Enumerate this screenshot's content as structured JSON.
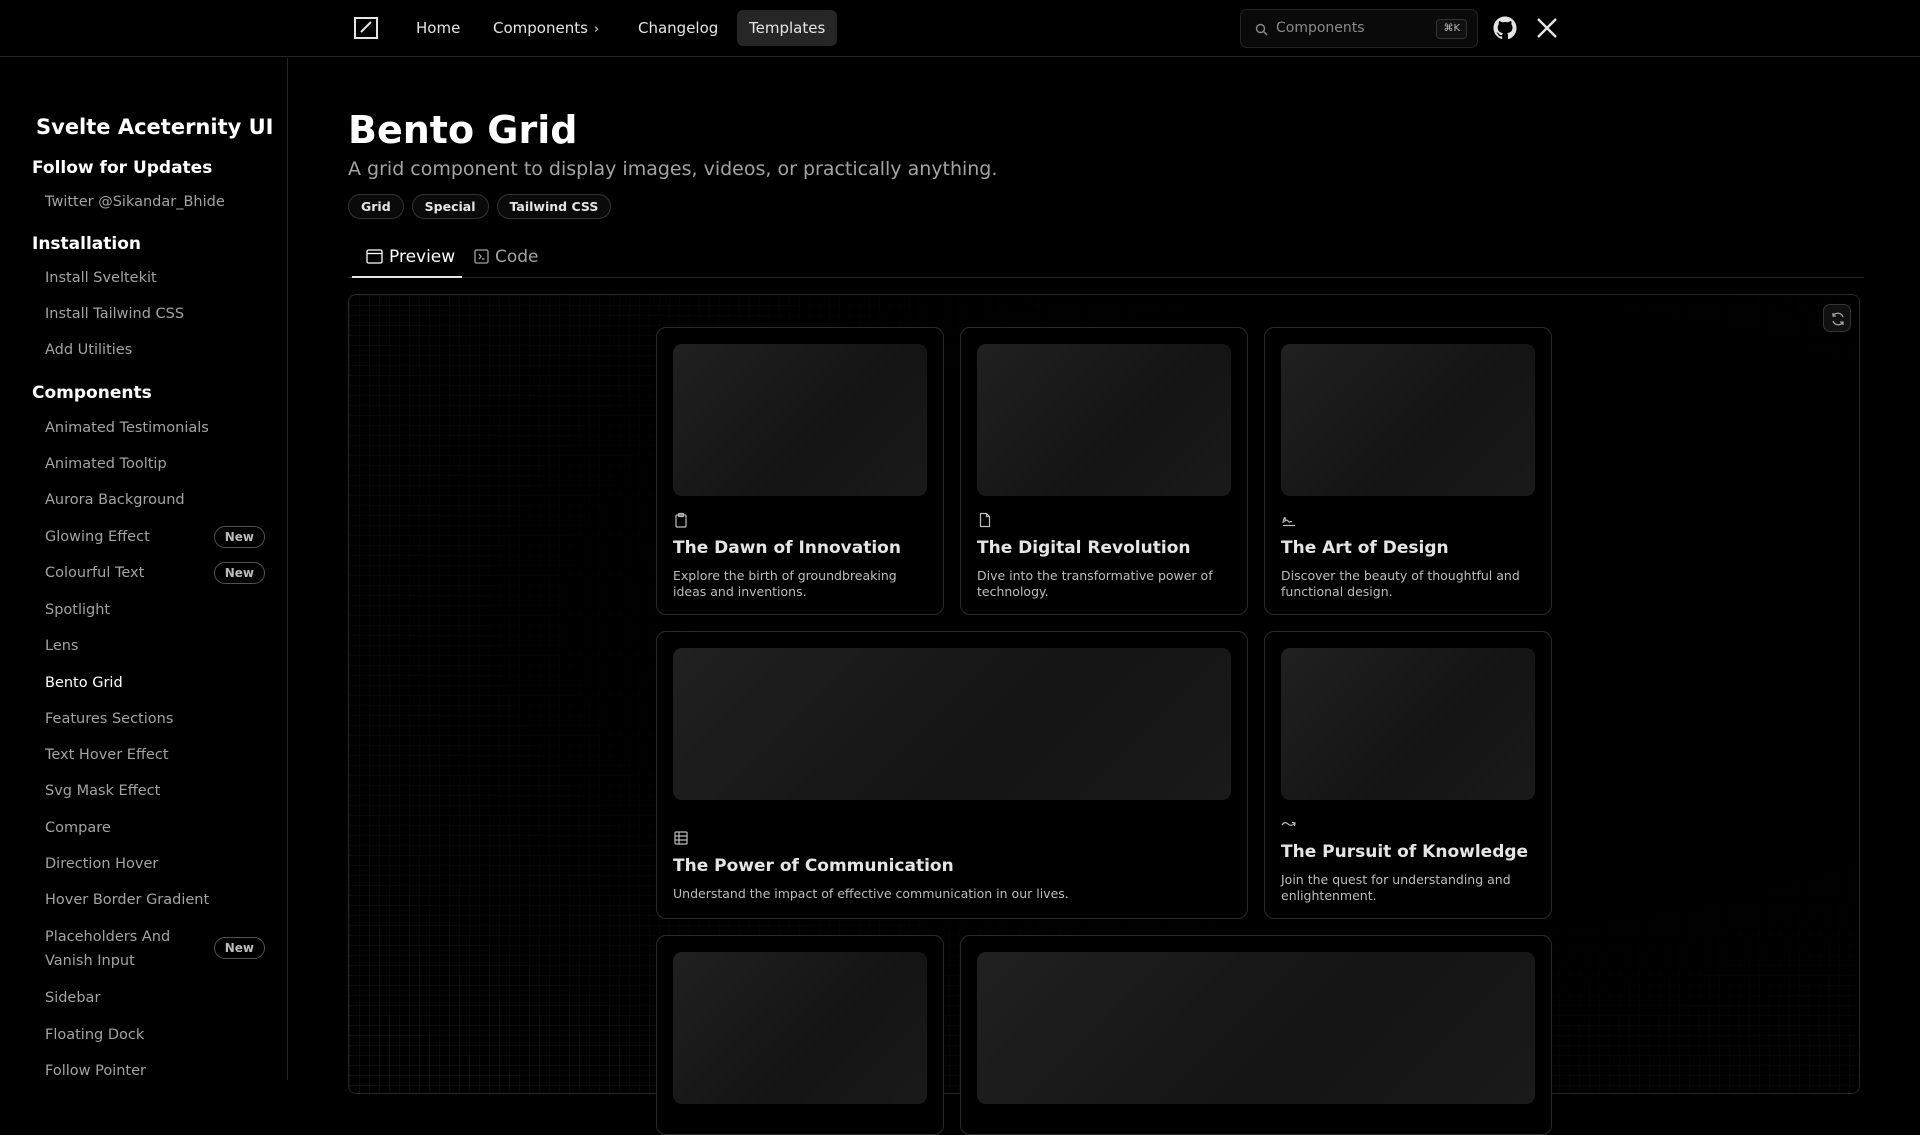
{
  "nav": {
    "home": "Home",
    "components": "Components",
    "changelog": "Changelog",
    "templates": "Templates",
    "search_placeholder": "Components",
    "search_shortcut": "⌘K"
  },
  "sidebar": {
    "brand": "Svelte Aceternity UI",
    "follow_title": "Follow for Updates",
    "twitter": "Twitter @Sikandar_Bhide",
    "installation_title": "Installation",
    "installation": [
      "Install Sveltekit",
      "Install Tailwind CSS",
      "Add Utilities"
    ],
    "components_title": "Components",
    "components": [
      {
        "label": "Animated Testimonials"
      },
      {
        "label": "Animated Tooltip"
      },
      {
        "label": "Aurora Background"
      },
      {
        "label": "Glowing Effect",
        "badge": "New"
      },
      {
        "label": "Colourful Text",
        "badge": "New"
      },
      {
        "label": "Spotlight"
      },
      {
        "label": "Lens"
      },
      {
        "label": "Bento Grid"
      },
      {
        "label": "Features Sections"
      },
      {
        "label": "Text Hover Effect"
      },
      {
        "label": "Svg Mask Effect"
      },
      {
        "label": "Compare"
      },
      {
        "label": "Direction Hover"
      },
      {
        "label": "Hover Border Gradient"
      },
      {
        "label": "Placeholders And Vanish Input",
        "badge": "New"
      },
      {
        "label": "Sidebar"
      },
      {
        "label": "Floating Dock"
      },
      {
        "label": "Follow Pointer"
      }
    ],
    "current": "Bento Grid"
  },
  "page": {
    "title": "Bento Grid",
    "subtitle": "A grid component to display images, videos, or practically anything.",
    "tags": [
      "Grid",
      "Special",
      "Tailwind CSS"
    ],
    "tabs": {
      "preview": "Preview",
      "code": "Code"
    }
  },
  "cards": [
    {
      "icon": "clipboard-copy-icon",
      "title": "The Dawn of Innovation",
      "desc": "Explore the birth of groundbreaking ideas and inventions."
    },
    {
      "icon": "file-icon",
      "title": "The Digital Revolution",
      "desc": "Dive into the transformative power of technology."
    },
    {
      "icon": "signature-icon",
      "title": "The Art of Design",
      "desc": "Discover the beauty of thoughtful and functional design."
    },
    {
      "icon": "table-columns-icon",
      "title": "The Power of Communication",
      "desc": "Understand the impact of effective communication in our lives."
    },
    {
      "icon": "arrow-wave-icon",
      "title": "The Pursuit of Knowledge",
      "desc": "Join the quest for understanding and enlightenment."
    }
  ]
}
